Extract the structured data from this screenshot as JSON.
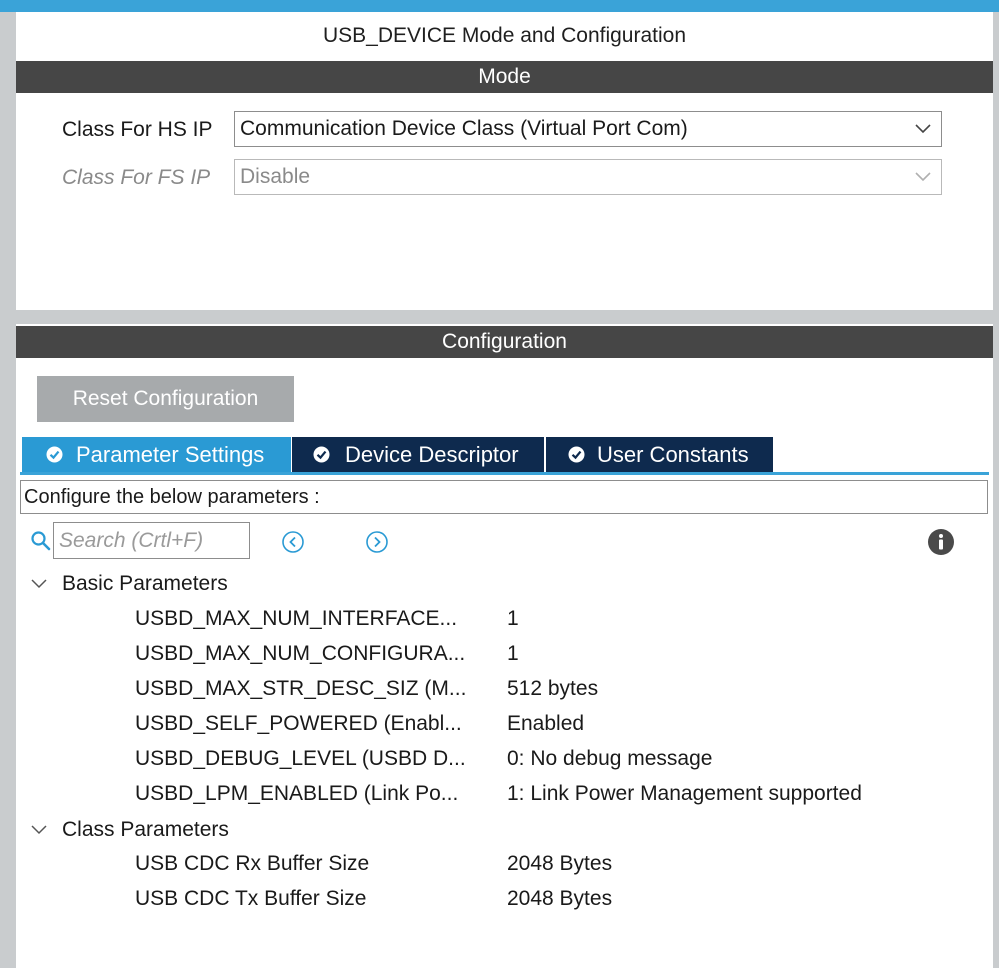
{
  "window": {
    "title": "USB_DEVICE Mode and Configuration"
  },
  "mode": {
    "header": "Mode",
    "rows": [
      {
        "label": "Class For HS IP",
        "value": "Communication Device Class (Virtual Port Com)",
        "enabled": true
      },
      {
        "label": "Class For FS IP",
        "value": "Disable",
        "enabled": false
      }
    ]
  },
  "configuration": {
    "header": "Configuration",
    "reset_label": "Reset Configuration",
    "tabs": [
      {
        "label": "Parameter Settings",
        "active": true
      },
      {
        "label": "Device Descriptor",
        "active": false
      },
      {
        "label": "User Constants",
        "active": false
      }
    ],
    "description": "Configure the below parameters :",
    "search_placeholder": "Search (Crtl+F)",
    "groups": [
      {
        "name": "Basic Parameters",
        "params": [
          {
            "name": "USBD_MAX_NUM_INTERFACE...",
            "value": "1"
          },
          {
            "name": "USBD_MAX_NUM_CONFIGURA...",
            "value": "1"
          },
          {
            "name": "USBD_MAX_STR_DESC_SIZ (M...",
            "value": "512 bytes"
          },
          {
            "name": "USBD_SELF_POWERED (Enabl...",
            "value": "Enabled"
          },
          {
            "name": "USBD_DEBUG_LEVEL (USBD D...",
            "value": "0: No debug message"
          },
          {
            "name": "USBD_LPM_ENABLED (Link Po...",
            "value": "1: Link Power Management supported"
          }
        ]
      },
      {
        "name": "Class Parameters",
        "params": [
          {
            "name": "USB CDC Rx Buffer Size",
            "value": "2048 Bytes"
          },
          {
            "name": "USB CDC Tx Buffer Size",
            "value": "2048 Bytes"
          }
        ]
      }
    ]
  },
  "colors": {
    "accent": "#3aa3d8",
    "tab_active": "#2a9ad4",
    "tab_inactive": "#0e2a4e",
    "header_bg": "#464646",
    "button_bg": "#a7aaac"
  },
  "icons": {
    "tab_icon": "check-circle-icon",
    "search": "search-icon",
    "prev": "circle-chevron-left-icon",
    "next": "circle-chevron-right-icon",
    "info": "info-icon",
    "dropdown": "chevron-down-icon",
    "group_toggle": "chevron-down-icon"
  }
}
